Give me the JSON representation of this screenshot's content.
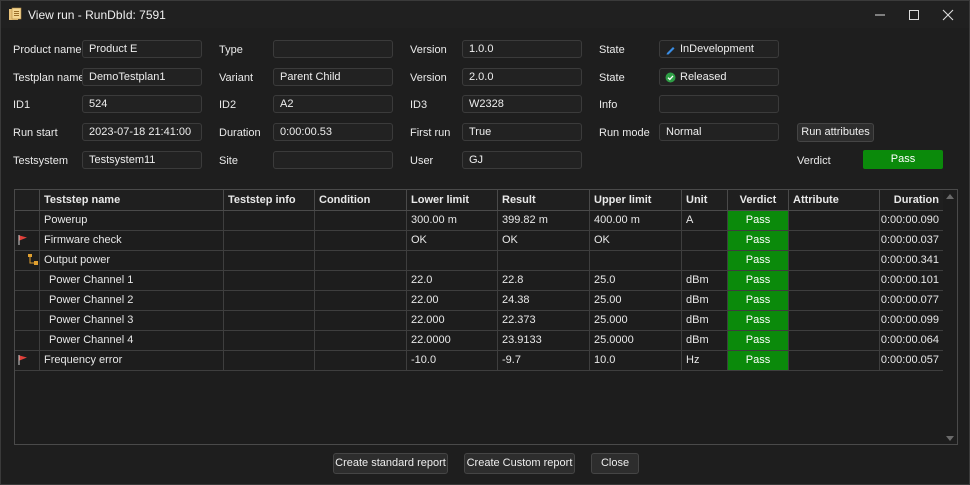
{
  "window": {
    "title": "View run - RunDbId: 7591"
  },
  "info": {
    "product_name_label": "Product name",
    "product_name": "Product E",
    "type_label": "Type",
    "type": "",
    "version1_label": "Version",
    "version1": "1.0.0",
    "state1_label": "State",
    "state1": "InDevelopment",
    "testplan_label": "Testplan name",
    "testplan": "DemoTestplan1",
    "variant_label": "Variant",
    "variant": "Parent Child",
    "version2_label": "Version",
    "version2": "2.0.0",
    "state2_label": "State",
    "state2": "Released",
    "id1_label": "ID1",
    "id1": "524",
    "id2_label": "ID2",
    "id2": "A2",
    "id3_label": "ID3",
    "id3": "W2328",
    "info_label": "Info",
    "info": "",
    "run_start_label": "Run start",
    "run_start": "2023-07-18 21:41:00",
    "duration_label": "Duration",
    "duration": "0:00:00.53",
    "first_run_label": "First run",
    "first_run": "True",
    "run_mode_label": "Run mode",
    "run_mode": "Normal",
    "run_attributes_button": "Run attributes",
    "testsystem_label": "Testsystem",
    "testsystem": "Testsystem11",
    "site_label": "Site",
    "site": "",
    "user_label": "User",
    "user": "GJ",
    "verdict_label": "Verdict",
    "verdict": "Pass"
  },
  "grid": {
    "columns": [
      "Teststep name",
      "Teststep info",
      "Condition",
      "Lower limit",
      "Result",
      "Upper limit",
      "Unit",
      "Verdict",
      "Attribute",
      "Duration"
    ],
    "rows": [
      {
        "icon": "",
        "name": "Powerup",
        "info": "",
        "condition": "",
        "lower": "300.00 m",
        "result": "399.82 m",
        "upper": "400.00 m",
        "unit": "A",
        "verdict": "Pass",
        "attribute": "",
        "duration": "0:00:00.090"
      },
      {
        "icon": "flag-icon",
        "name": "Firmware check",
        "info": "",
        "condition": "",
        "lower": "OK",
        "result": "OK",
        "upper": "OK",
        "unit": "",
        "verdict": "Pass",
        "attribute": "",
        "duration": "0:00:00.037"
      },
      {
        "icon": "tree-icon",
        "name": "Output power",
        "info": "",
        "condition": "",
        "lower": "",
        "result": "",
        "upper": "",
        "unit": "",
        "verdict": "Pass",
        "attribute": "",
        "duration": "0:00:00.341"
      },
      {
        "icon": "",
        "name": "Power Channel 1",
        "info": "",
        "condition": "",
        "lower": "22.0",
        "result": "22.8",
        "upper": "25.0",
        "unit": "dBm",
        "verdict": "Pass",
        "attribute": "",
        "duration": "0:00:00.101"
      },
      {
        "icon": "",
        "name": "Power Channel 2",
        "info": "",
        "condition": "",
        "lower": "22.00",
        "result": "24.38",
        "upper": "25.00",
        "unit": "dBm",
        "verdict": "Pass",
        "attribute": "",
        "duration": "0:00:00.077"
      },
      {
        "icon": "",
        "name": "Power Channel 3",
        "info": "",
        "condition": "",
        "lower": "22.000",
        "result": "22.373",
        "upper": "25.000",
        "unit": "dBm",
        "verdict": "Pass",
        "attribute": "",
        "duration": "0:00:00.099"
      },
      {
        "icon": "",
        "name": "Power Channel 4",
        "info": "",
        "condition": "",
        "lower": "22.0000",
        "result": "23.9133",
        "upper": "25.0000",
        "unit": "dBm",
        "verdict": "Pass",
        "attribute": "",
        "duration": "0:00:00.064"
      },
      {
        "icon": "flag-icon",
        "name": "Frequency error",
        "info": "",
        "condition": "",
        "lower": "-10.0",
        "result": "-9.7",
        "upper": "10.0",
        "unit": "Hz",
        "verdict": "Pass",
        "attribute": "",
        "duration": "0:00:00.057"
      }
    ]
  },
  "footer": {
    "standard_report": "Create standard report",
    "custom_report": "Create Custom report",
    "close": "Close"
  },
  "colors": {
    "pass": "#0b8a0b",
    "flag": "#e0403a",
    "edit": "#3a8ee6"
  }
}
